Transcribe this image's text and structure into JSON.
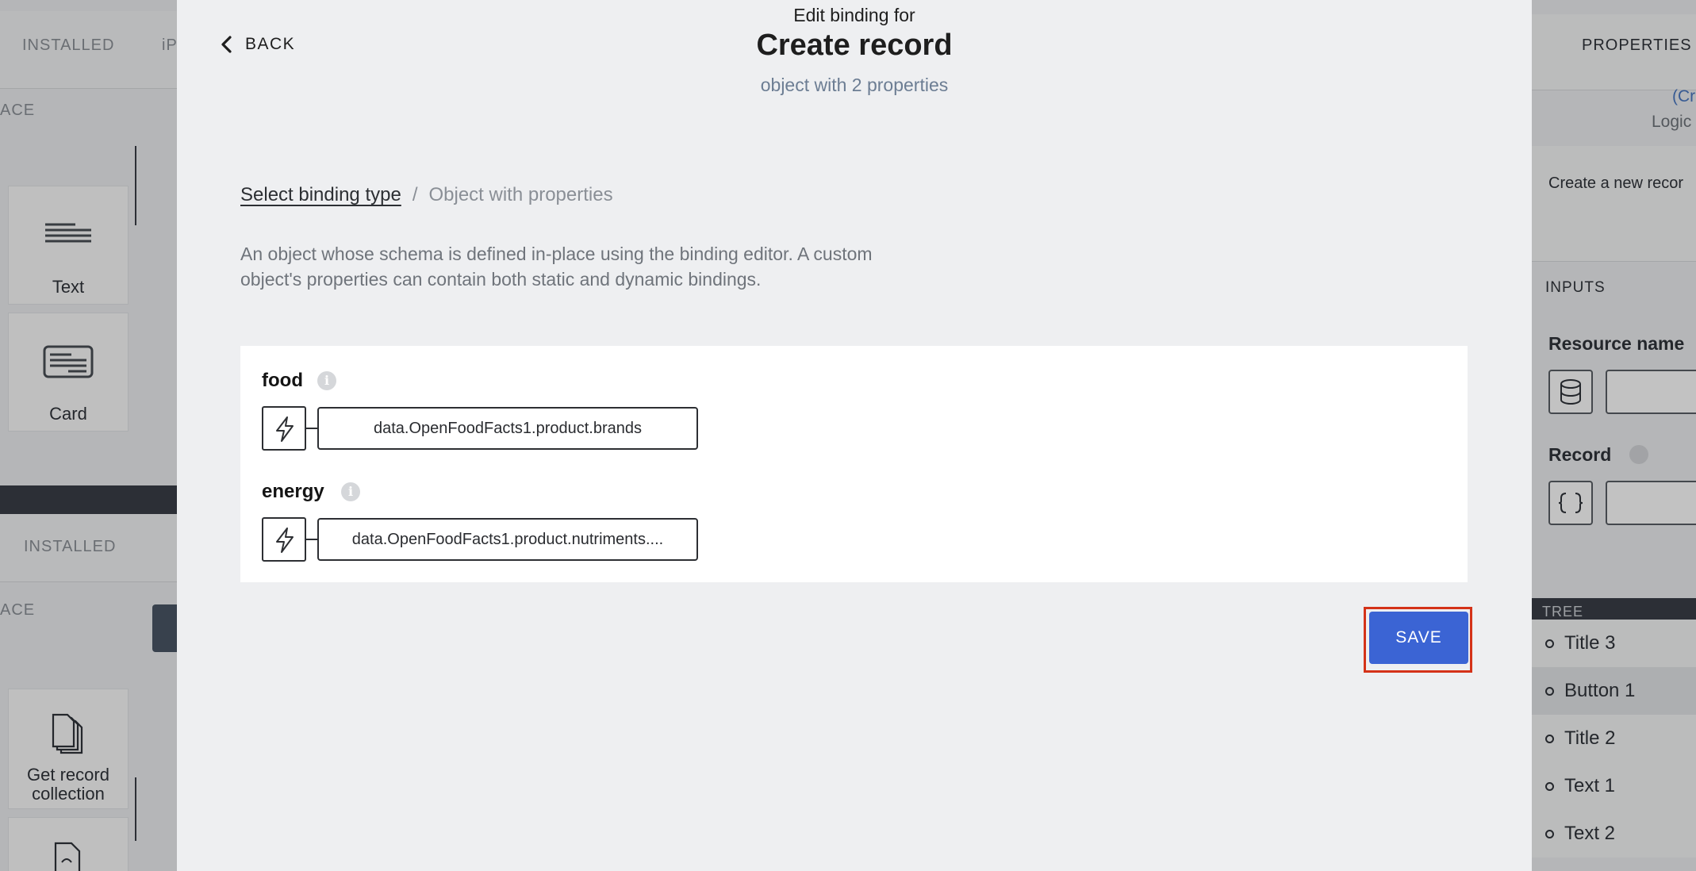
{
  "background_left": {
    "top_tabs": {
      "installed": "INSTALLED",
      "cut_tab": "iP"
    },
    "marketplace_fragment": "ACE",
    "components": [
      {
        "label": "Text",
        "icon": "text-lines-icon"
      },
      {
        "label": "Card",
        "icon": "card-icon"
      }
    ],
    "bottom_tabs": {
      "installed": "INSTALLED"
    },
    "marketplace_fragment_2": "ACE",
    "actions": [
      {
        "label": "Get record collection",
        "icon": "documents-stack-icon"
      },
      {
        "label": "",
        "icon": "document-icon"
      }
    ]
  },
  "background_right": {
    "properties_tab": "PROPERTIES",
    "component_name_fragment": "(Cr",
    "logic_fragment": "Logic",
    "description_fragment": "Create a new recor",
    "inputs_header": "INPUTS",
    "resource_name_label": "Resource name",
    "record_label": "Record",
    "tree_header": "TREE",
    "tree_items": [
      "Title 3",
      "Button 1",
      "Title 2",
      "Text 1",
      "Text 2"
    ]
  },
  "modal": {
    "back_label": "BACK",
    "kicker": "Edit binding for",
    "title": "Create record",
    "subtitle": "object with 2 properties",
    "breadcrumb": {
      "link": "Select binding type",
      "separator": "/",
      "current": "Object with properties"
    },
    "description": "An object whose schema is defined in-place using the binding editor. A custom object's properties can contain both static and dynamic bindings.",
    "properties": [
      {
        "name": "food",
        "binding": "data.OpenFoodFacts1.product.brands"
      },
      {
        "name": "energy",
        "binding": "data.OpenFoodFacts1.product.nutriments...."
      }
    ],
    "save_label": "SAVE"
  },
  "colors": {
    "accent": "#3b64d4",
    "highlight_outline": "#d43218",
    "subtitle": "#6c7d93"
  }
}
